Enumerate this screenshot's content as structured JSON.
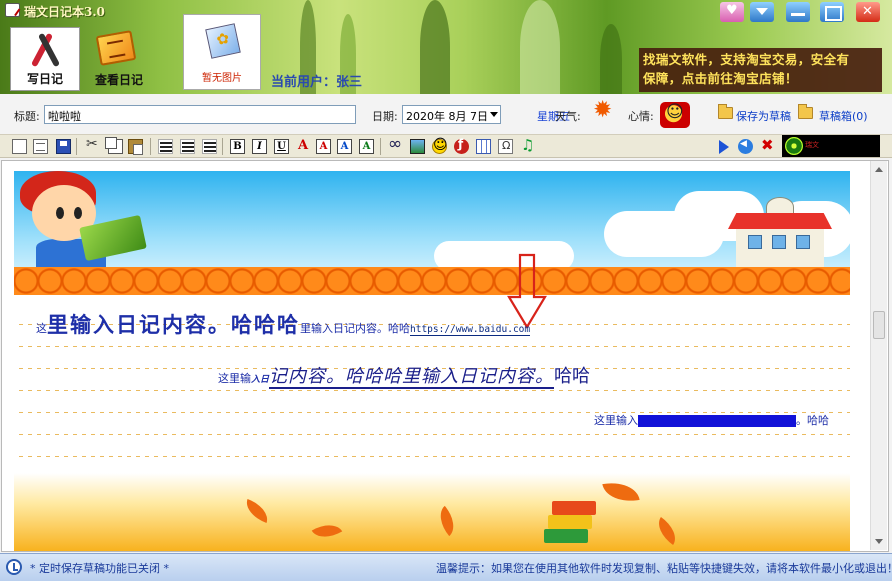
{
  "window": {
    "title": "瑞文日记本3.0"
  },
  "nav": {
    "write_label": "写日记",
    "view_label": "查看日记"
  },
  "photo": {
    "label": "暂无图片"
  },
  "user": {
    "prefix": "当前用户：",
    "name": "张三"
  },
  "promo": {
    "line1": "找瑞文软件，支持淘宝交易，安全有",
    "line2": "保障，点击前往淘宝店铺！"
  },
  "form": {
    "title_label": "标题:",
    "title_value": "啦啦啦",
    "date_label": "日期:",
    "date_value": "2020年 8月 7日",
    "weekday": "星期五",
    "weather_label": "天气:",
    "weather_icon": "sun-icon",
    "mood_label": "心情:",
    "mood_icon": "smiley-icon",
    "save_draft_label": "保存为草稿",
    "drafts_label": "草稿箱(0)"
  },
  "toolbar": {
    "bold": "B",
    "italic": "I",
    "underline": "U",
    "font": "A",
    "fontbg": "A",
    "fontcolor": "A",
    "fontsize": "A",
    "player_tag": "瑞文"
  },
  "editor": {
    "line1_prefix": "这",
    "line1_big": "里输入日记内容。哈哈哈",
    "line1_small": "里输入日记内容。哈哈",
    "line1_url": "https://www.baidu.com",
    "line2_prefix": "这里输",
    "line2_ab": "入日",
    "line2_mid": "记内容。哈哈哈里输入日记内容。",
    "line2_tail": "哈哈",
    "line3_prefix": "这里输入",
    "line3_suffix": "。哈哈"
  },
  "status": {
    "left": "* 定时保存草稿功能已关闭 *",
    "right": "温馨提示：如果您在使用其他软件时发现复制、粘贴等快捷键失效，请将本软件最小化或退出！"
  },
  "colors": {
    "accent": "#1a3a9a",
    "promo_bg": "#48200e",
    "promo_text": "#ffe35c",
    "fence": "#f47b18",
    "sky": "#2fb3ef"
  }
}
